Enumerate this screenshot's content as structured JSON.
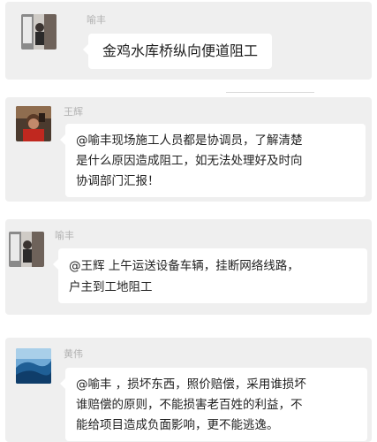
{
  "messages": [
    {
      "sender": "喻丰",
      "avatar": "photo-avatar-yufeng",
      "text": "金鸡水库桥纵向便道阻工"
    },
    {
      "sender": "王辉",
      "avatar": "photo-avatar-wanghui",
      "text": "@喻丰现场施工人员都是协调员，了解清楚\n是什么原因造成阻工，如无法处理好及时向\n协调部门汇报！"
    },
    {
      "sender": "喻丰",
      "avatar": "photo-avatar-yufeng",
      "text": "@王辉 上午运送设备车辆，挂断网络线路，\n户主到工地阻工"
    },
    {
      "sender": "黄伟",
      "avatar": "photo-avatar-huangwei",
      "text": "@喻丰 ，损坏东西，照价赔偿，采用谁损坏\n谁赔偿的原则，不能损害老百姓的利益，不\n能给项目造成负面影响，更不能逃逸。"
    }
  ],
  "colors": {
    "card_background": "#efefef",
    "bubble_background": "#ffffff",
    "sender_name": "#b2b2b2",
    "message_text": "#1f1f1f"
  }
}
